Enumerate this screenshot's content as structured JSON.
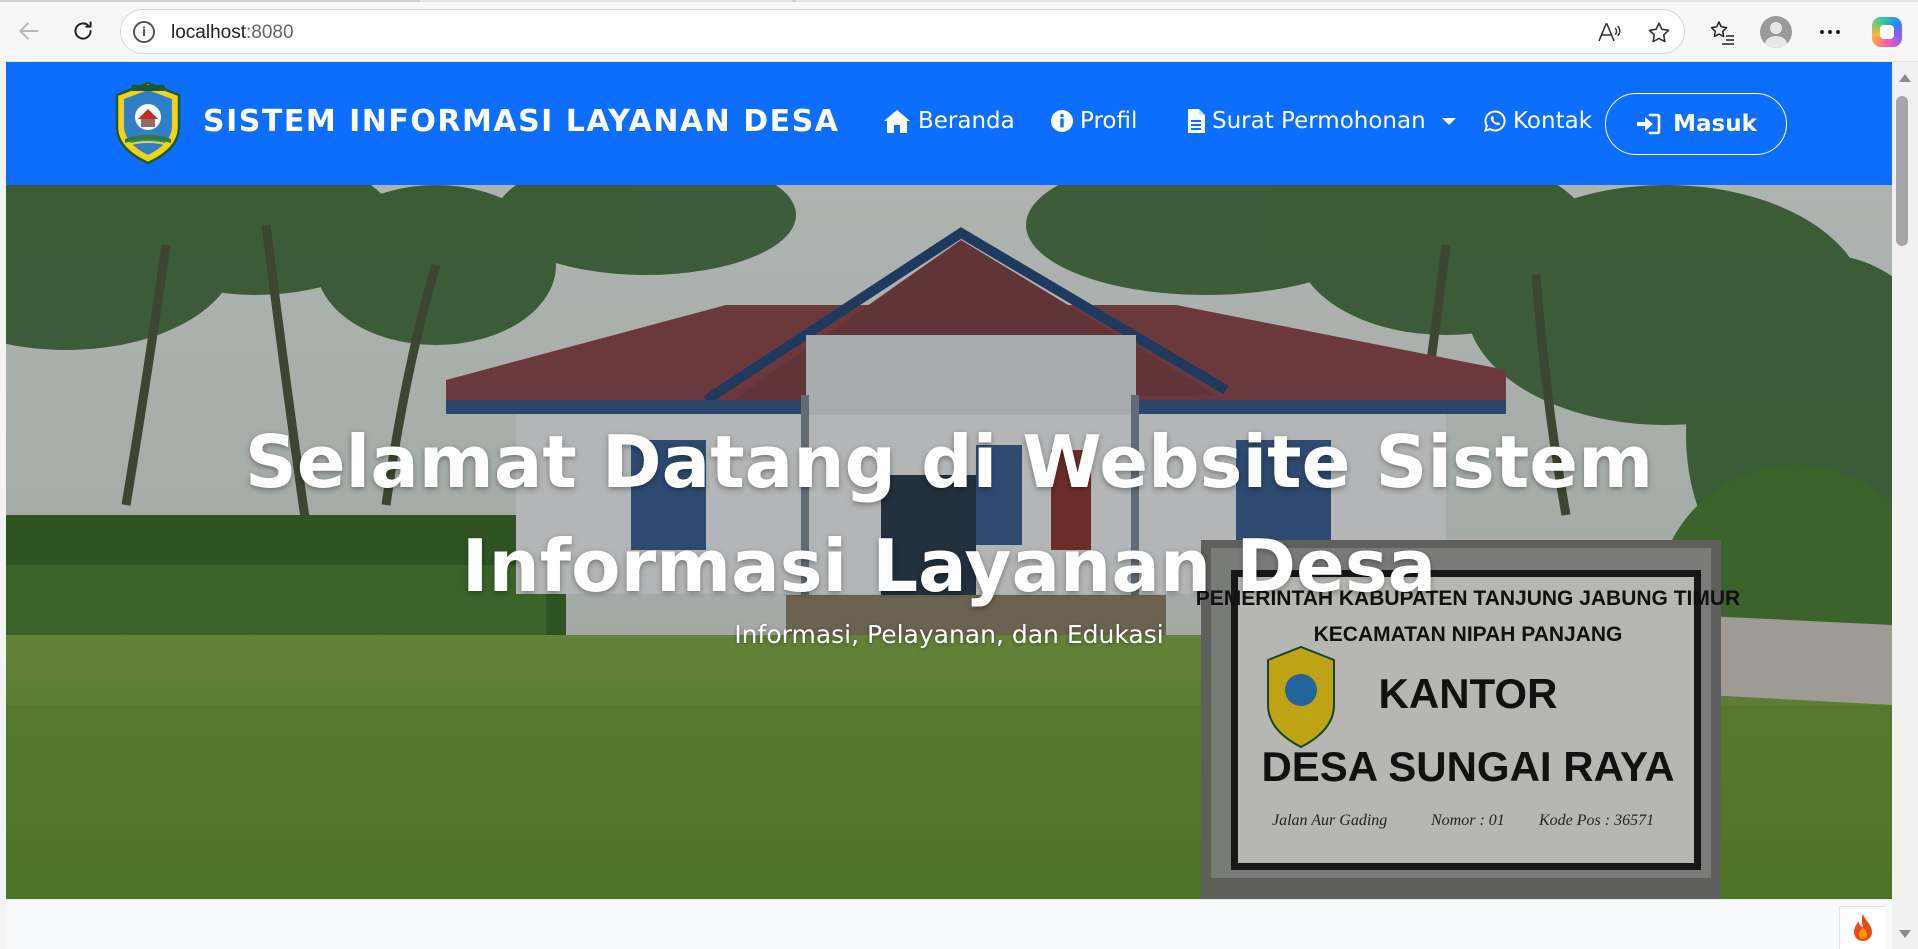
{
  "browser": {
    "url_host": "localhost",
    "url_port": ":8080"
  },
  "site": {
    "brand_title": "SISTEM INFORMASI LAYANAN DESA",
    "nav": {
      "home": "Beranda",
      "profile": "Profil",
      "letters": "Surat Permohonan",
      "contact": "Kontak",
      "login": "Masuk"
    },
    "accent_color": "#0d6efd"
  },
  "hero": {
    "title_line1": "Selamat Datang di Website Sistem",
    "title_line2": "Informasi Layanan Desa",
    "subtitle": "Informasi, Pelayanan, dan Edukasi",
    "sign": {
      "line1": "PEMERINTAH KABUPATEN TANJUNG JABUNG TIMUR",
      "line2": "KECAMATAN NIPAH PANJANG",
      "line3": "KANTOR",
      "line4": "DESA SUNGAI RAYA",
      "address": "Jalan Aur Gading",
      "number": "Nomor : 01",
      "postal": "Kode Pos : 36571"
    }
  }
}
